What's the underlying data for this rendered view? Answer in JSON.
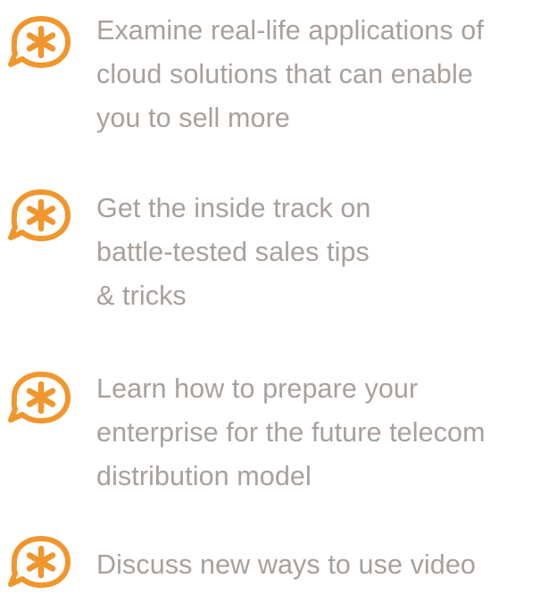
{
  "accent_color": "#f0962c",
  "text_color": "#a8a09b",
  "bullet_icon": "asterisk-speech-bubble-icon",
  "items": [
    {
      "lines": [
        "Examine real-life applications of",
        "cloud solutions that can enable",
        "you to sell more"
      ]
    },
    {
      "lines": [
        "Get the inside track on",
        "battle-tested sales tips",
        "& tricks"
      ]
    },
    {
      "lines": [
        "Learn how to prepare your",
        "enterprise for the future telecom",
        "distribution model"
      ]
    },
    {
      "lines": [
        "Discuss new ways to use video"
      ]
    }
  ]
}
